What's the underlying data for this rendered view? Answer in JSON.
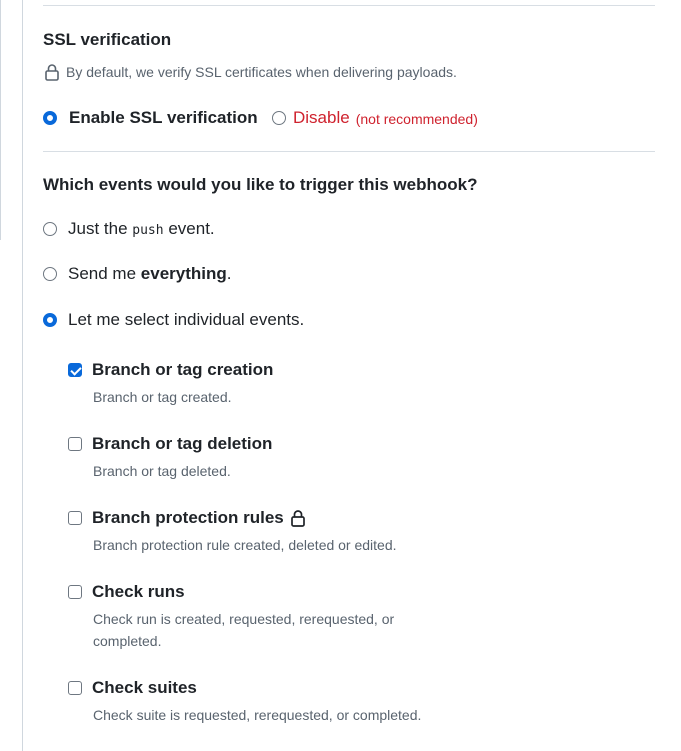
{
  "ssl": {
    "title": "SSL verification",
    "note": "By default, we verify SSL certificates when delivering payloads.",
    "enable_label": "Enable SSL verification",
    "enable_checked": true,
    "disable_label": "Disable",
    "disable_note": "(not recommended)",
    "disable_checked": false
  },
  "events": {
    "title": "Which events would you like to trigger this webhook?",
    "options": {
      "push_prefix": "Just the",
      "push_code": "push",
      "push_suffix": "event.",
      "everything_prefix": "Send me",
      "everything_bold": "everything",
      "everything_suffix": ".",
      "individual": "Let me select individual events."
    },
    "selected_option": "individual",
    "items": [
      {
        "title": "Branch or tag creation",
        "desc": "Branch or tag created.",
        "checked": true,
        "locked": false
      },
      {
        "title": "Branch or tag deletion",
        "desc": "Branch or tag deleted.",
        "checked": false,
        "locked": false
      },
      {
        "title": "Branch protection rules",
        "desc": "Branch protection rule created, deleted or edited.",
        "checked": false,
        "locked": true
      },
      {
        "title": "Check runs",
        "desc": "Check run is created, requested, rerequested, or completed.",
        "checked": false,
        "locked": false
      },
      {
        "title": "Check suites",
        "desc": "Check suite is requested, rerequested, or completed.",
        "checked": false,
        "locked": false
      }
    ]
  },
  "colors": {
    "accent": "#0969da",
    "danger": "#cf222e",
    "muted": "#59636e"
  }
}
